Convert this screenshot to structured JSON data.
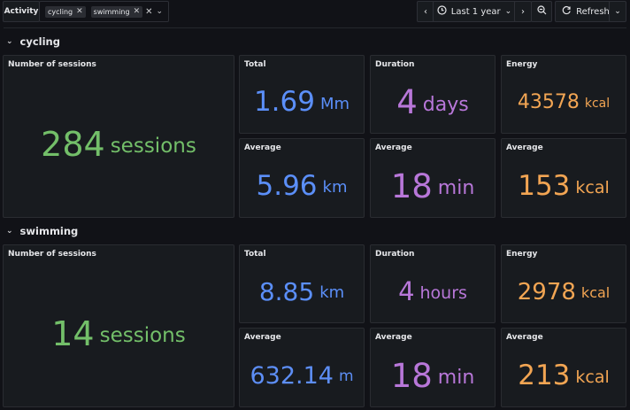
{
  "topbar": {
    "variable_label": "Activity",
    "chips": [
      "cycling",
      "swimming"
    ],
    "time_range": "Last 1 year",
    "refresh_label": "Refresh"
  },
  "rows": [
    {
      "title": "cycling",
      "sessions": {
        "title": "Number of sessions",
        "value": "284",
        "unit": "sessions"
      },
      "total": {
        "title": "Total",
        "value": "1.69",
        "unit": "Mm"
      },
      "duration": {
        "title": "Duration",
        "value": "4",
        "unit": "days"
      },
      "energy": {
        "title": "Energy",
        "value": "43578",
        "unit": "kcal"
      },
      "avg_distance": {
        "title": "Average",
        "value": "5.96",
        "unit": "km"
      },
      "avg_duration": {
        "title": "Average",
        "value": "18",
        "unit": "min"
      },
      "avg_energy": {
        "title": "Average",
        "value": "153",
        "unit": "kcal"
      }
    },
    {
      "title": "swimming",
      "sessions": {
        "title": "Number of sessions",
        "value": "14",
        "unit": "sessions"
      },
      "total": {
        "title": "Total",
        "value": "8.85",
        "unit": "km"
      },
      "duration": {
        "title": "Duration",
        "value": "4",
        "unit": "hours"
      },
      "energy": {
        "title": "Energy",
        "value": "2978",
        "unit": "kcal"
      },
      "avg_distance": {
        "title": "Average",
        "value": "632.14",
        "unit": "m"
      },
      "avg_duration": {
        "title": "Average",
        "value": "18",
        "unit": "min"
      },
      "avg_energy": {
        "title": "Average",
        "value": "213",
        "unit": "kcal"
      }
    }
  ],
  "colors": {
    "sessions": "#73bf69",
    "distance": "#5b8ff9",
    "duration": "#b877d9",
    "energy": "#f2a553"
  },
  "icons": {
    "chip_remove": "close-icon",
    "clear": "close-icon",
    "dropdown": "chevron-down-icon",
    "prev": "chevron-left-icon",
    "next": "chevron-right-icon",
    "clock": "clock-icon",
    "zoom_out": "zoom-out-icon",
    "refresh": "refresh-icon",
    "row_toggle": "chevron-down-icon"
  }
}
